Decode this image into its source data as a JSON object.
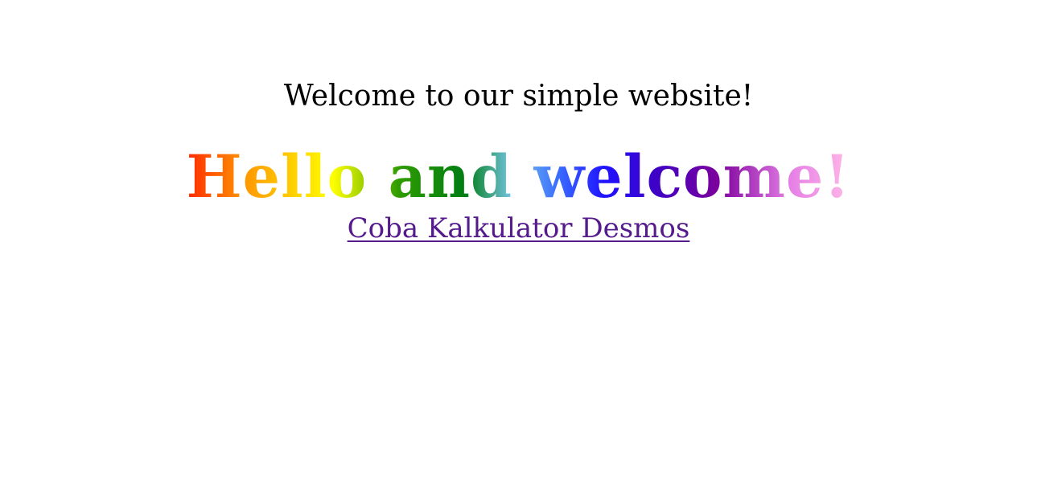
{
  "intro": {
    "text": "Welcome to our simple website!"
  },
  "heading": {
    "text": "Hello and welcome!",
    "gradient_colors": [
      "#ff2a00",
      "#ff9900",
      "#ffff00",
      "#2e9b00",
      "#007d14",
      "#76c5e6",
      "#3a6cff",
      "#1f12ff",
      "#4000c4",
      "#7c009c",
      "#e680e6",
      "#ffb8e6"
    ]
  },
  "link": {
    "label": "Coba Kalkulator Desmos",
    "color": "#551a8b"
  }
}
